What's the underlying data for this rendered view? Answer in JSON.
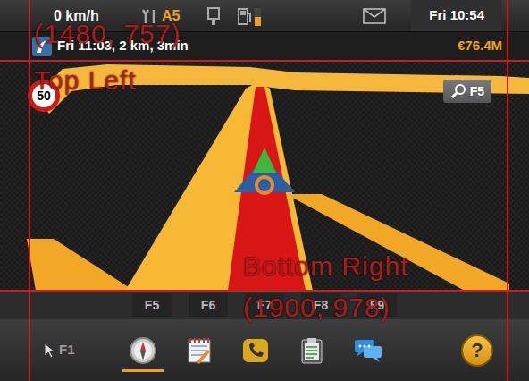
{
  "top_bar": {
    "speed": "0 km/h",
    "road": "A5",
    "fuel": {
      "level": 0.5
    },
    "time": "Fri 10:54"
  },
  "route_bar": {
    "eta": "Fri 11:03, 2 km, 3min",
    "money": "€76.4M"
  },
  "map": {
    "speed_limit": "50",
    "zoom_key": "F5"
  },
  "fkeys": [
    {
      "label": "F5"
    },
    {
      "label": "F6"
    },
    {
      "label": "F7"
    },
    {
      "label": "F8"
    },
    {
      "label": "F9"
    }
  ],
  "toolbar": {
    "pointer_key": "F1",
    "tabs": [
      {
        "kind": "compass",
        "selected": true
      },
      {
        "kind": "notepad",
        "selected": false
      },
      {
        "kind": "phone",
        "selected": false
      },
      {
        "kind": "clipboard",
        "selected": false
      },
      {
        "kind": "chat",
        "selected": false
      }
    ],
    "help": {
      "label": "?"
    }
  },
  "annotations": [
    {
      "label": "(1480, 757)"
    },
    {
      "label": "Top Left"
    },
    {
      "label": "Bottom Right"
    },
    {
      "label": "(1900, 978)"
    }
  ]
}
